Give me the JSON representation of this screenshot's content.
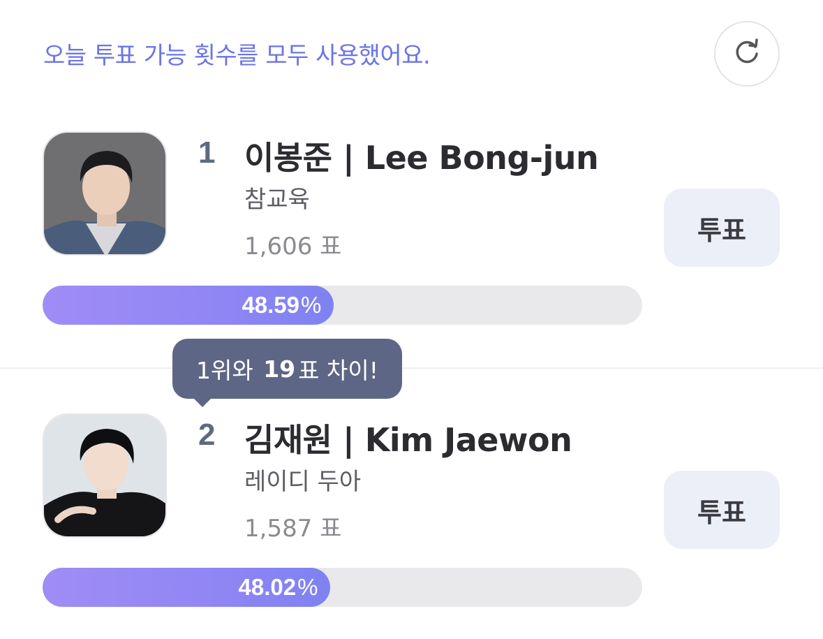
{
  "notice": "오늘 투표 가능 횟수를 모두 사용했어요.",
  "icons": {
    "refresh": "refresh-icon"
  },
  "colors": {
    "accent": "#6b74e6",
    "bar_start": "#a08cf6",
    "bar_end": "#7f82f2",
    "tooltip_bg": "#5e6686"
  },
  "candidates": [
    {
      "rank": "1",
      "name": "이봉준 | Lee Bong-jun",
      "group": "참교육",
      "votes": "1,606",
      "votes_unit": "표",
      "percent_value": "48.59",
      "percent_sign": "%",
      "percent": 48.59,
      "vote_label": "투표"
    },
    {
      "rank": "2",
      "name": "김재원 | Kim Jaewon",
      "group": "레이디 두아",
      "votes": "1,587",
      "votes_unit": "표",
      "percent_value": "48.02",
      "percent_sign": "%",
      "percent": 48.02,
      "vote_label": "투표"
    }
  ],
  "gap_tooltip": {
    "prefix": "1위와",
    "count": "19",
    "suffix": "표 차이!"
  }
}
